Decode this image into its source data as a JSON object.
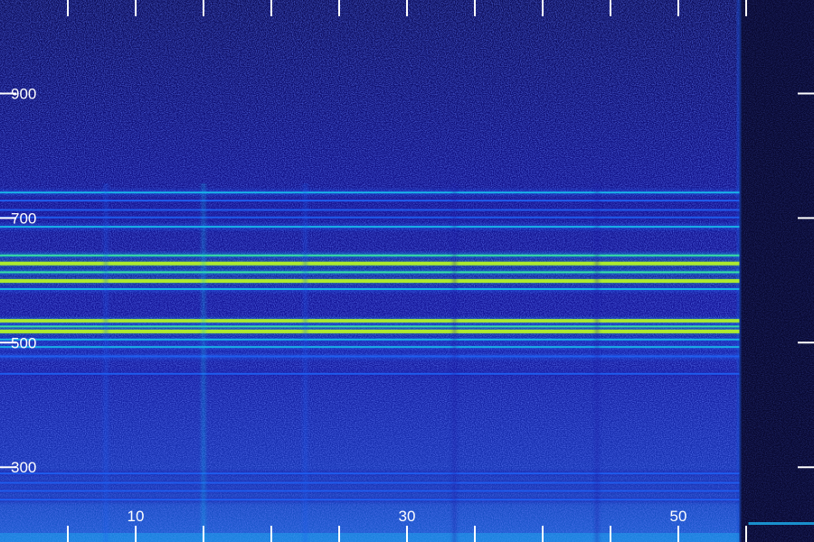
{
  "chart_data": {
    "type": "heatmap",
    "title": "",
    "xlabel": "",
    "ylabel": "",
    "x_ticks": [
      10,
      30,
      50
    ],
    "y_ticks": [
      300,
      500,
      700,
      900
    ],
    "x_minor_ticks": [
      5,
      15,
      20,
      25,
      35,
      40,
      45,
      55
    ],
    "xlim": [
      0,
      60
    ],
    "ylim": [
      180,
      1050
    ],
    "signal_end_x": 54.5,
    "colormap": [
      "#06062e",
      "#1a1aa8",
      "#1f5ff0",
      "#19b4e8",
      "#39e6a0",
      "#b4f028"
    ],
    "lines": [
      {
        "y": 741,
        "intensity": 0.55
      },
      {
        "y": 728,
        "intensity": 0.4
      },
      {
        "y": 713,
        "intensity": 0.35
      },
      {
        "y": 701,
        "intensity": 0.35
      },
      {
        "y": 686,
        "intensity": 0.6
      },
      {
        "y": 640,
        "intensity": 0.8
      },
      {
        "y": 627,
        "intensity": 1.0
      },
      {
        "y": 613,
        "intensity": 0.75
      },
      {
        "y": 599,
        "intensity": 1.0
      },
      {
        "y": 586,
        "intensity": 0.5
      },
      {
        "y": 535,
        "intensity": 0.9
      },
      {
        "y": 526,
        "intensity": 0.7
      },
      {
        "y": 518,
        "intensity": 1.0
      },
      {
        "y": 505,
        "intensity": 0.6
      },
      {
        "y": 493,
        "intensity": 0.5
      },
      {
        "y": 478,
        "intensity": 0.45
      },
      {
        "y": 450,
        "intensity": 0.35
      },
      {
        "y": 290,
        "intensity": 0.35
      },
      {
        "y": 275,
        "intensity": 0.35
      },
      {
        "y": 262,
        "intensity": 0.4
      },
      {
        "y": 248,
        "intensity": 0.4
      }
    ],
    "vertical_streaks": [
      {
        "x": 15.0,
        "intensity": 0.55
      },
      {
        "x": 7.8,
        "intensity": 0.3
      },
      {
        "x": 22.5,
        "intensity": 0.3
      },
      {
        "x": 33.5,
        "intensity": 0.25
      },
      {
        "x": 44.0,
        "intensity": 0.2
      }
    ]
  },
  "colors": {
    "background": "#05052a",
    "tick": "#ffffff"
  }
}
